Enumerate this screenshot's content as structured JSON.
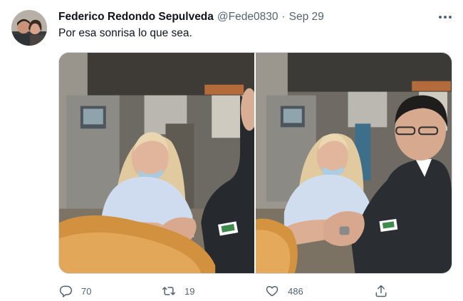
{
  "tweet": {
    "author_name": "Federico Redondo Sepulveda",
    "author_handle": "@Fede0830",
    "separator": "·",
    "date": "Sep 29",
    "text": "Por esa sonrisa lo que sea."
  },
  "actions": {
    "replies": "70",
    "retweets": "19",
    "likes": "486"
  },
  "icons": {
    "more": "more-horizontal-icon",
    "reply": "reply-icon",
    "retweet": "retweet-icon",
    "like": "heart-icon",
    "share": "share-icon"
  },
  "colors": {
    "text": "#0f1419",
    "secondary": "#536471",
    "border": "#d5dbe0"
  }
}
